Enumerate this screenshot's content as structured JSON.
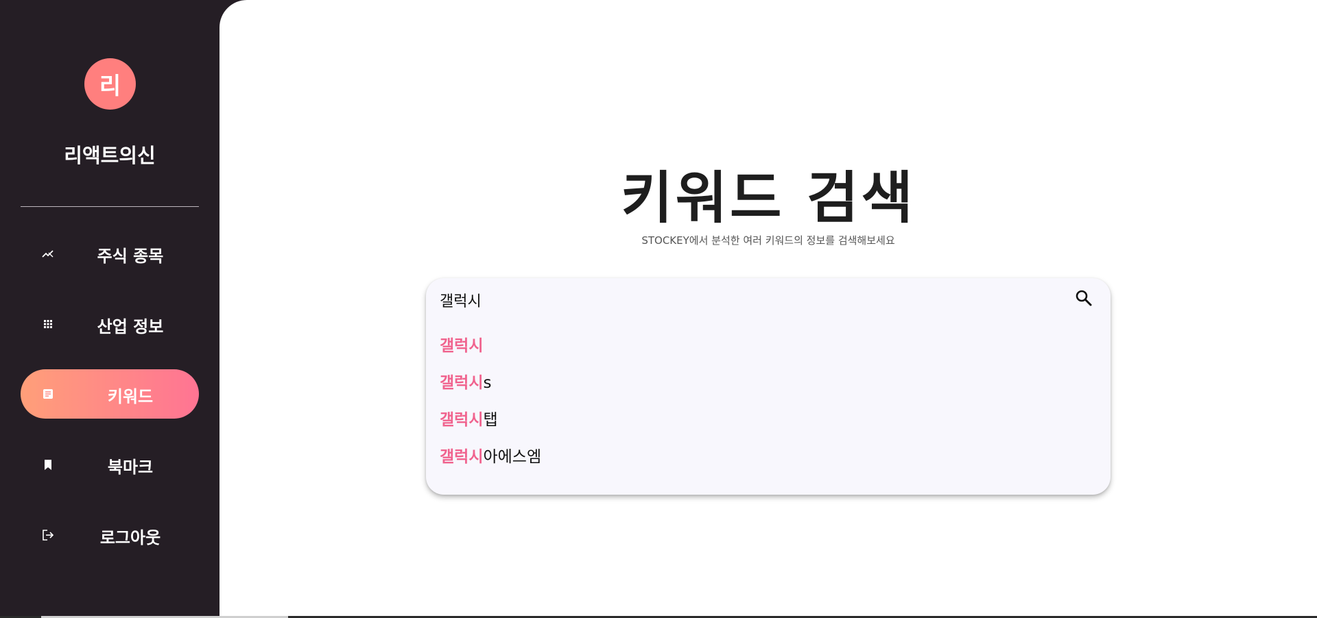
{
  "sidebar": {
    "avatar_initial": "리",
    "username": "리액트의신",
    "items": [
      {
        "label": "주식 종목",
        "icon": "stock-chart-icon"
      },
      {
        "label": "산업 정보",
        "icon": "grid-icon"
      },
      {
        "label": "키워드",
        "icon": "document-icon",
        "active": true
      },
      {
        "label": "북마크",
        "icon": "bookmark-icon"
      },
      {
        "label": "로그아웃",
        "icon": "logout-icon"
      }
    ]
  },
  "main": {
    "title": "키워드 검색",
    "subtitle": "STOCKEY에서 분석한 여러 키워드의 정보를 검색해보세요"
  },
  "search": {
    "value": "갤럭시",
    "suggestions": [
      {
        "match": "갤럭시",
        "rest": ""
      },
      {
        "match": "갤럭시",
        "rest": "s"
      },
      {
        "match": "갤럭시",
        "rest": "탭"
      },
      {
        "match": "갤럭시",
        "rest": "아에스엠"
      }
    ]
  },
  "colors": {
    "sidebar_bg": "#251e25",
    "accent_gradient_start": "#ff9f79",
    "accent_gradient_end": "#ff7493",
    "highlight": "#f0638e",
    "avatar_bg": "#ff7f7e"
  }
}
